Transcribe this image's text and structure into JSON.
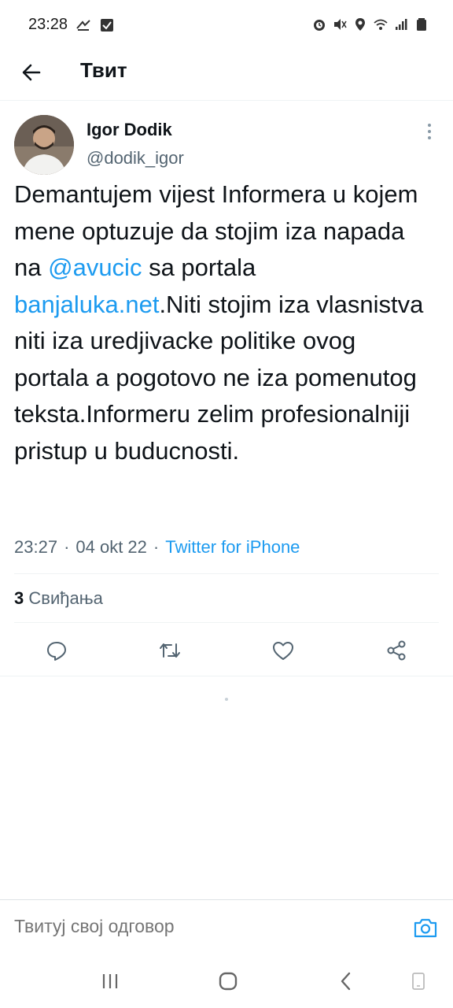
{
  "status_bar": {
    "time": "23:28",
    "left_icons": [
      "gesture-icon",
      "checkbox-notification-icon"
    ],
    "right_icons": [
      "alarm-icon",
      "mute-icon",
      "location-icon",
      "wifi-icon",
      "signal-icon",
      "battery-icon"
    ]
  },
  "header": {
    "title": "Твит"
  },
  "tweet": {
    "author_name": "Igor Dodik",
    "author_handle": "@dodik_igor",
    "text_part1": "Demantujem vijest Informera u kojem mene optuzuje da stojim iza napada na ",
    "mention": "@avucic",
    "text_part2": " sa portala ",
    "link": "banjaluka.net",
    "text_part3": ".Niti stojim iza vlasnistva niti iza uredjivacke politike ovog portala a pogotovo ne iza pomenutog teksta.Informeru zelim profesionalniji pristup u buducnosti.",
    "time": "23:27",
    "separator": "·",
    "date": "04 okt 22",
    "source": "Twitter for iPhone",
    "likes_count": "3",
    "likes_label": "Свиђања"
  },
  "actions": [
    "reply-icon",
    "retweet-icon",
    "like-icon",
    "share-icon"
  ],
  "reply_bar": {
    "placeholder": "Твитуј свој одговор"
  },
  "colors": {
    "accent": "#1d9bf0",
    "text_primary": "#0f1419",
    "text_secondary": "#536471",
    "divider": "#eff3f4"
  }
}
